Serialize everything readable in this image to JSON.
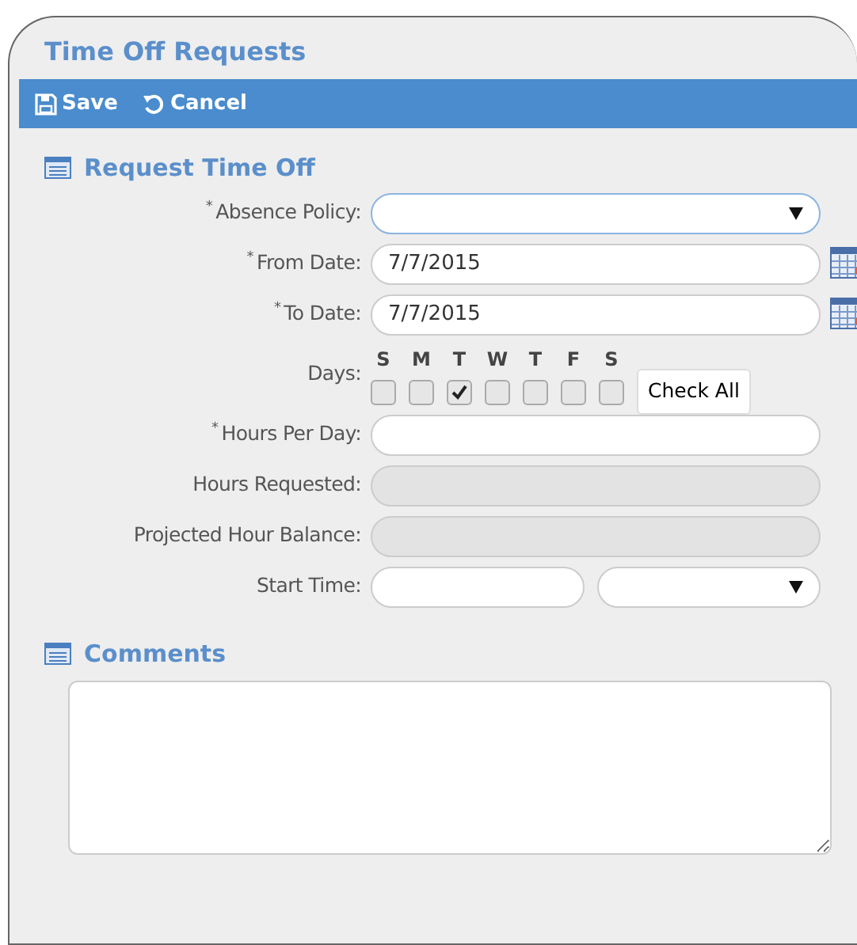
{
  "window": {
    "title": "Time Off Requests"
  },
  "toolbar": [
    {
      "kind": "save",
      "label": "Save"
    },
    {
      "kind": "cancel",
      "label": "Cancel"
    }
  ],
  "section": {
    "title": "Request Time Off"
  },
  "fields": [
    {
      "kind": "select",
      "label": "Absence Policy:",
      "required_mark": "*",
      "focused": true
    },
    {
      "kind": "date",
      "label": "From Date:",
      "required_mark": "*",
      "value": "7/7/2015"
    },
    {
      "kind": "date",
      "label": "To Date:",
      "required_mark": "*",
      "value": "7/7/2015"
    },
    {
      "kind": "days",
      "label": "Days:",
      "days": [
        {
          "letter": "S",
          "checked": false
        },
        {
          "letter": "M",
          "checked": false
        },
        {
          "letter": "T",
          "checked": true
        },
        {
          "letter": "W",
          "checked": false
        },
        {
          "letter": "T",
          "checked": false
        },
        {
          "letter": "F",
          "checked": false
        },
        {
          "letter": "S",
          "checked": false
        }
      ],
      "button": "Check All"
    },
    {
      "kind": "text",
      "label": "Hours Per Day:",
      "required_mark": "*",
      "disabled": false
    },
    {
      "kind": "text",
      "label": "Hours Requested:",
      "disabled": true
    },
    {
      "kind": "text",
      "label": "Projected Hour Balance:",
      "disabled": true
    },
    {
      "kind": "time",
      "label": "Start Time:"
    }
  ],
  "comments": {
    "title": "Comments"
  }
}
